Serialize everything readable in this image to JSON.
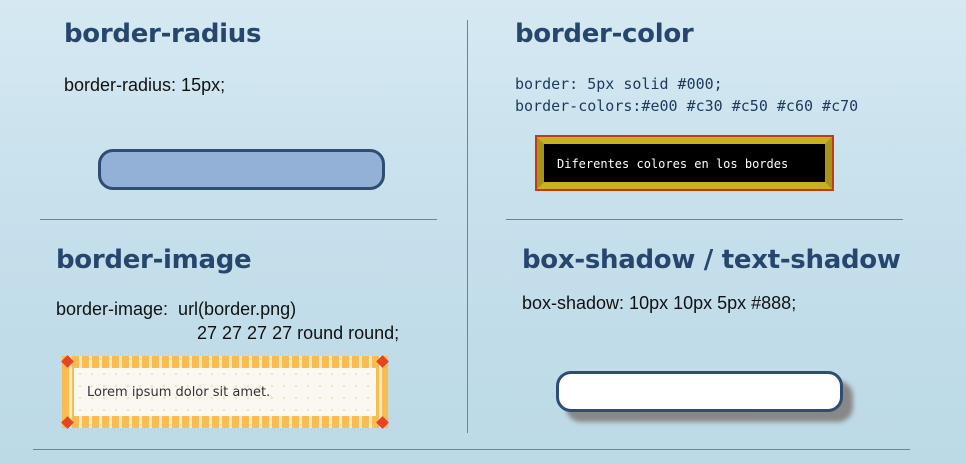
{
  "sections": {
    "radius": {
      "title": "border-radius",
      "code": "border-radius: 15px;"
    },
    "color": {
      "title": "border-color",
      "code_line1": "border: 5px solid #000;",
      "code_line2": "border-colors:#e00 #c30 #c50 #c60 #c70",
      "demo_text": "Diferentes colores en los bordes"
    },
    "image": {
      "title": "border-image",
      "code_line1": "border-image:  url(border.png)",
      "code_line2": "27 27 27 27 round round;",
      "demo_text": "Lorem ipsum dolor sit amet."
    },
    "shadow": {
      "title": "box-shadow / text-shadow",
      "code": "box-shadow: 10px 10px 5px #888;"
    }
  },
  "colors": {
    "title": "#27466d",
    "divider": "#5d86b3",
    "radius_fill": "#93b1d6",
    "radius_border": "#2d4d72"
  }
}
